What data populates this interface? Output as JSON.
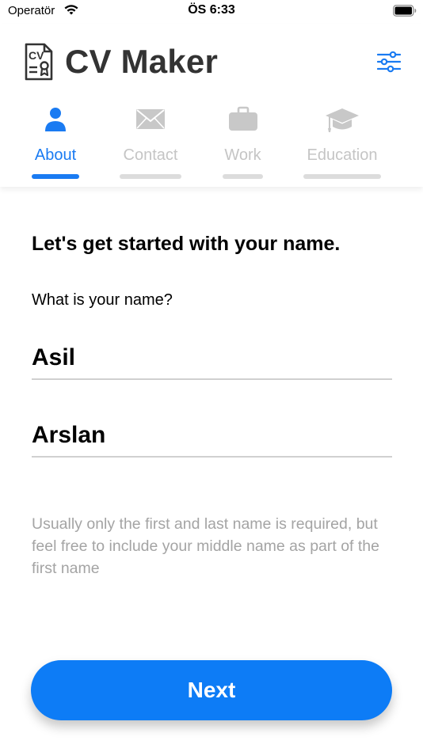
{
  "status_bar": {
    "carrier": "Operatör",
    "time": "ÖS 6:33"
  },
  "header": {
    "title": "CV Maker",
    "logo_icon": "cv-document-icon",
    "settings_icon": "sliders-icon"
  },
  "tabs": [
    {
      "label": "About",
      "icon": "person-icon",
      "active": true
    },
    {
      "label": "Contact",
      "icon": "envelope-icon",
      "active": false
    },
    {
      "label": "Work",
      "icon": "briefcase-icon",
      "active": false
    },
    {
      "label": "Education",
      "icon": "graduation-cap-icon",
      "active": false
    }
  ],
  "form": {
    "heading": "Let's get started with your name.",
    "question": "What is your name?",
    "first_name": "Asil",
    "last_name": "Arslan",
    "hint": "Usually only the first and last name is required, but feel free to include your middle name as part of the first name"
  },
  "next_button": {
    "label": "Next"
  },
  "colors": {
    "accent": "#0d7cf6",
    "inactive_tab": "#c5c5c5",
    "title": "#333333",
    "hint": "#a4a4a4"
  }
}
